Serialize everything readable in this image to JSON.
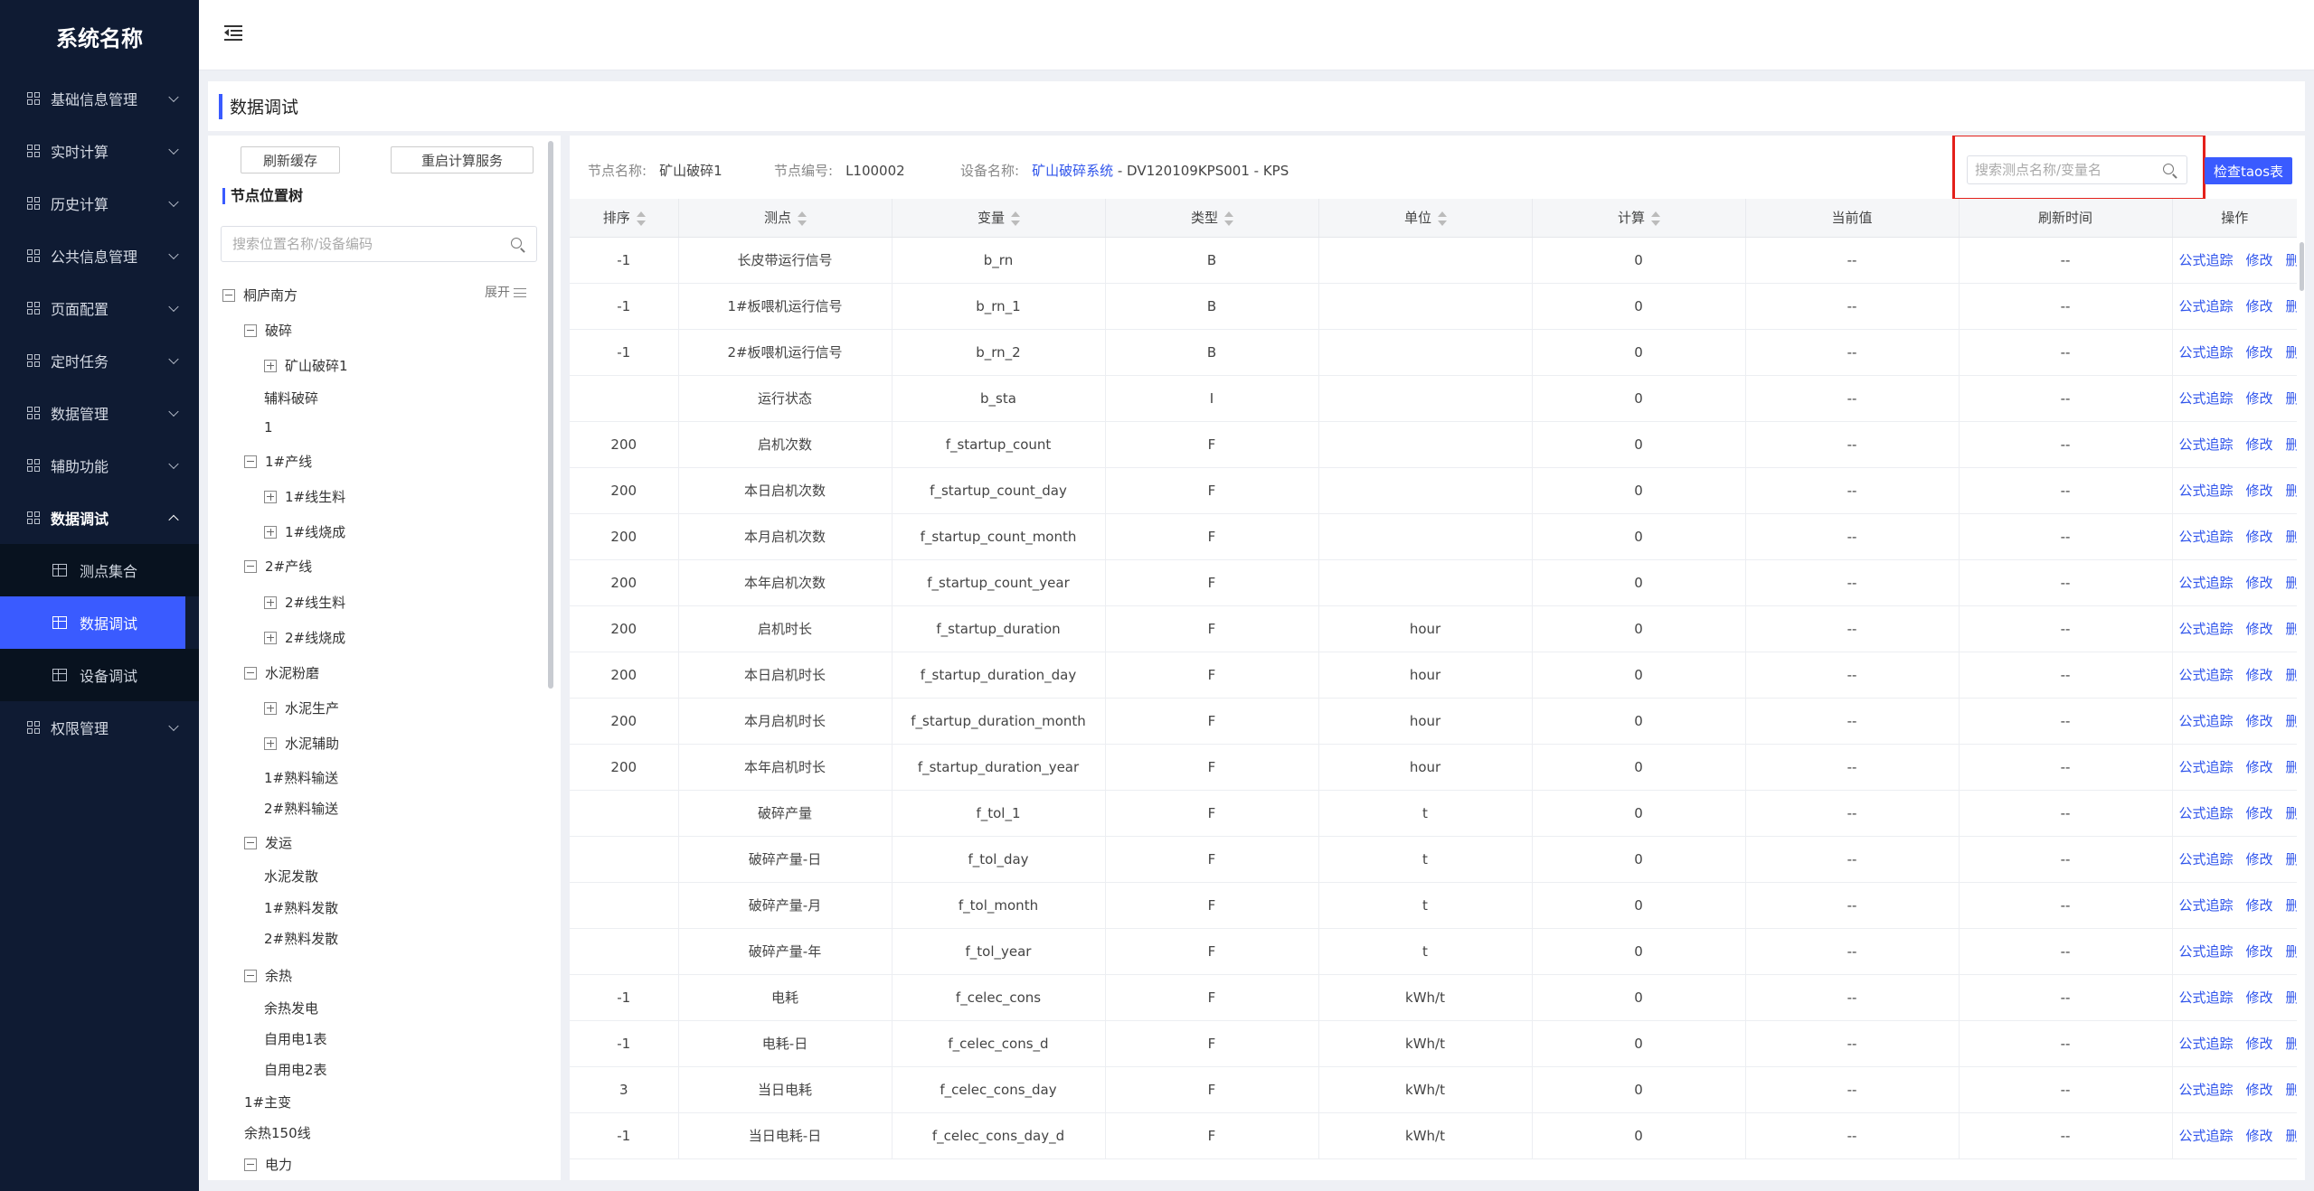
{
  "app": {
    "title": "系统名称"
  },
  "sidebar": {
    "items": [
      {
        "label": "基础信息管理"
      },
      {
        "label": "实时计算"
      },
      {
        "label": "历史计算"
      },
      {
        "label": "公共信息管理"
      },
      {
        "label": "页面配置"
      },
      {
        "label": "定时任务"
      },
      {
        "label": "数据管理"
      },
      {
        "label": "辅助功能"
      },
      {
        "label": "数据调试",
        "expanded": true
      },
      {
        "label": "权限管理"
      }
    ],
    "submenu": [
      {
        "label": "测点集合"
      },
      {
        "label": "数据调试",
        "active": true
      },
      {
        "label": "设备调试"
      }
    ]
  },
  "page": {
    "title": "数据调试"
  },
  "tree_panel": {
    "refresh_cache_label": "刷新缓存",
    "restart_service_label": "重启计算服务",
    "section_title": "节点位置树",
    "search_placeholder": "搜索位置名称/设备编码",
    "expand_label": "展开",
    "nodes": [
      "桐庐南方",
      "破碎",
      "矿山破碎1",
      "辅料破碎",
      "1",
      "1#产线",
      "1#线生料",
      "1#线烧成",
      "2#产线",
      "2#线生料",
      "2#线烧成",
      "水泥粉磨",
      "水泥生产",
      "水泥辅助",
      "1#熟料输送",
      "2#熟料输送",
      "发运",
      "水泥发散",
      "1#熟料发散",
      "2#熟料发散",
      "余热",
      "余热发电",
      "自用电1表",
      "自用电2表",
      "1#主变",
      "余热150线",
      "电力"
    ]
  },
  "main": {
    "node_name_label": "节点名称:",
    "node_name_value": "矿山破碎1",
    "node_code_label": "节点编号:",
    "node_code_value": "L100002",
    "device_name_label": "设备名称:",
    "device_link": "矿山破碎系统",
    "device_suffix": "- DV120109KPS001 - KPS",
    "search_placeholder": "搜索测点名称/变量名",
    "check_button_label": "检查taos表",
    "columns": [
      "排序",
      "测点",
      "变量",
      "类型",
      "单位",
      "计算",
      "当前值",
      "刷新时间",
      "操作"
    ],
    "action_labels": {
      "trace": "公式追踪",
      "edit": "修改",
      "delete": "删除"
    },
    "rows": [
      {
        "order": "-1",
        "point": "长皮带运行信号",
        "var": "b_rn",
        "type": "B",
        "unit": "",
        "calc": "0",
        "current": "--",
        "refresh": "--"
      },
      {
        "order": "-1",
        "point": "1#板喂机运行信号",
        "var": "b_rn_1",
        "type": "B",
        "unit": "",
        "calc": "0",
        "current": "--",
        "refresh": "--"
      },
      {
        "order": "-1",
        "point": "2#板喂机运行信号",
        "var": "b_rn_2",
        "type": "B",
        "unit": "",
        "calc": "0",
        "current": "--",
        "refresh": "--"
      },
      {
        "order": "",
        "point": "运行状态",
        "var": "b_sta",
        "type": "I",
        "unit": "",
        "calc": "0",
        "current": "--",
        "refresh": "--"
      },
      {
        "order": "200",
        "point": "启机次数",
        "var": "f_startup_count",
        "type": "F",
        "unit": "",
        "calc": "0",
        "current": "--",
        "refresh": "--"
      },
      {
        "order": "200",
        "point": "本日启机次数",
        "var": "f_startup_count_day",
        "type": "F",
        "unit": "",
        "calc": "0",
        "current": "--",
        "refresh": "--"
      },
      {
        "order": "200",
        "point": "本月启机次数",
        "var": "f_startup_count_month",
        "type": "F",
        "unit": "",
        "calc": "0",
        "current": "--",
        "refresh": "--"
      },
      {
        "order": "200",
        "point": "本年启机次数",
        "var": "f_startup_count_year",
        "type": "F",
        "unit": "",
        "calc": "0",
        "current": "--",
        "refresh": "--"
      },
      {
        "order": "200",
        "point": "启机时长",
        "var": "f_startup_duration",
        "type": "F",
        "unit": "hour",
        "calc": "0",
        "current": "--",
        "refresh": "--"
      },
      {
        "order": "200",
        "point": "本日启机时长",
        "var": "f_startup_duration_day",
        "type": "F",
        "unit": "hour",
        "calc": "0",
        "current": "--",
        "refresh": "--"
      },
      {
        "order": "200",
        "point": "本月启机时长",
        "var": "f_startup_duration_month",
        "type": "F",
        "unit": "hour",
        "calc": "0",
        "current": "--",
        "refresh": "--"
      },
      {
        "order": "200",
        "point": "本年启机时长",
        "var": "f_startup_duration_year",
        "type": "F",
        "unit": "hour",
        "calc": "0",
        "current": "--",
        "refresh": "--"
      },
      {
        "order": "",
        "point": "破碎产量",
        "var": "f_tol_1",
        "type": "F",
        "unit": "t",
        "calc": "0",
        "current": "--",
        "refresh": "--"
      },
      {
        "order": "",
        "point": "破碎产量-日",
        "var": "f_tol_day",
        "type": "F",
        "unit": "t",
        "calc": "0",
        "current": "--",
        "refresh": "--"
      },
      {
        "order": "",
        "point": "破碎产量-月",
        "var": "f_tol_month",
        "type": "F",
        "unit": "t",
        "calc": "0",
        "current": "--",
        "refresh": "--"
      },
      {
        "order": "",
        "point": "破碎产量-年",
        "var": "f_tol_year",
        "type": "F",
        "unit": "t",
        "calc": "0",
        "current": "--",
        "refresh": "--"
      },
      {
        "order": "-1",
        "point": "电耗",
        "var": "f_celec_cons",
        "type": "F",
        "unit": "kWh/t",
        "calc": "0",
        "current": "--",
        "refresh": "--"
      },
      {
        "order": "-1",
        "point": "电耗-日",
        "var": "f_celec_cons_d",
        "type": "F",
        "unit": "kWh/t",
        "calc": "0",
        "current": "--",
        "refresh": "--"
      },
      {
        "order": "3",
        "point": "当日电耗",
        "var": "f_celec_cons_day",
        "type": "F",
        "unit": "kWh/t",
        "calc": "0",
        "current": "--",
        "refresh": "--"
      },
      {
        "order": "-1",
        "point": "当日电耗-日",
        "var": "f_celec_cons_day_d",
        "type": "F",
        "unit": "kWh/t",
        "calc": "0",
        "current": "--",
        "refresh": "--"
      }
    ]
  },
  "colors": {
    "sidebar_bg": "#0f1b33",
    "accent": "#3a5bff",
    "highlight_border": "#e4201a",
    "link": "#2f54eb"
  }
}
